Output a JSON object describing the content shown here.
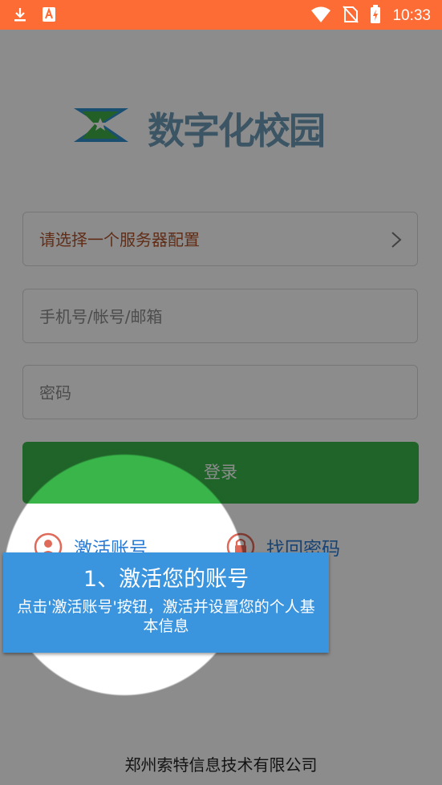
{
  "status_bar": {
    "time": "10:33",
    "left_icons": [
      "download-icon",
      "app-notification-icon"
    ],
    "right_icons": [
      "wifi-icon",
      "no-sim-icon",
      "battery-charging-icon"
    ]
  },
  "logo": {
    "text": "数字化校园"
  },
  "form": {
    "server_select": {
      "label": "请选择一个服务器配置"
    },
    "account": {
      "placeholder": "手机号/帐号/邮箱",
      "value": ""
    },
    "password": {
      "placeholder": "密码",
      "value": ""
    },
    "login_label": "登录"
  },
  "links": {
    "activate_label": "激活账号",
    "recover_label": "找回密码"
  },
  "tutorial": {
    "title": "1、激活您的账号",
    "body": "点击'激活账号'按钮，激活并设置您的个人基本信息"
  },
  "footer": {
    "company": "郑州索特信息技术有限公司"
  },
  "colors": {
    "status_bar": "#fe6c35",
    "login_button": "#39b54a",
    "link": "#2a7bd4",
    "tooltip": "#3b95de",
    "server_text": "#b0522a"
  }
}
